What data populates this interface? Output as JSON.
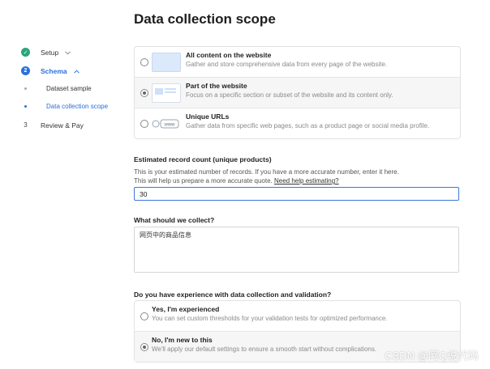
{
  "page": {
    "title": "Data collection scope"
  },
  "sidebar": {
    "steps": [
      {
        "number": "✓",
        "label": "Setup",
        "status": "done"
      },
      {
        "number": "2",
        "label": "Schema",
        "status": "active"
      },
      {
        "number": "3",
        "label": "Review & Pay",
        "status": "pending"
      }
    ],
    "substeps": [
      {
        "label": "Dataset sample"
      },
      {
        "label": "Data collection scope"
      }
    ]
  },
  "scope": {
    "options": [
      {
        "title": "All content on the website",
        "desc": "Gather and store comprehensive data from every page of the website.",
        "selected": false
      },
      {
        "title": "Part of the website",
        "desc": "Focus on a specific section or subset of the website and its content only.",
        "selected": true
      },
      {
        "title": "Unique URLs",
        "desc": "Gather data from specific web pages, such as a product page or social media profile.",
        "selected": false,
        "thumb_text": "www"
      }
    ]
  },
  "record_count": {
    "label": "Estimated record count (unique products)",
    "help_line1": "This is your estimated number of records. If you have a more accurate number, enter it here.",
    "help_line2": "This will help us prepare a more accurate quote.",
    "help_link": "Need help estimating?",
    "value": "30"
  },
  "collect": {
    "label": "What should we collect?",
    "value": "网页中的商品信息"
  },
  "experience": {
    "label": "Do you have experience with data collection and validation?",
    "options": [
      {
        "title": "Yes, I'm experienced",
        "desc": "You can set custom thresholds for your validation tests for optimized performance.",
        "selected": false
      },
      {
        "title": "No, I'm new to this",
        "desc": "We'll apply our default settings to ensure a smooth start without complications.",
        "selected": true
      }
    ]
  },
  "watermark": "CSDN @阿Q说代码",
  "colors": {
    "accent": "#2a6fdb",
    "done": "#2aa57b"
  }
}
